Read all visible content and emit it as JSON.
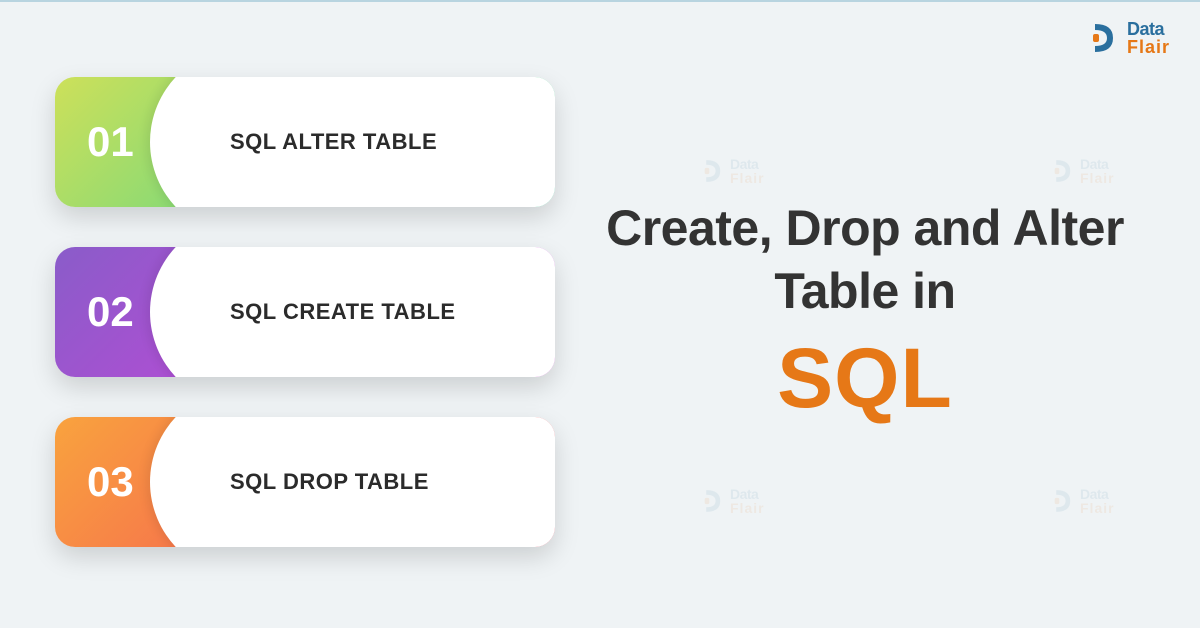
{
  "logo": {
    "top": "Data",
    "bottom": "Flair"
  },
  "cards": [
    {
      "num": "01",
      "label": "SQL ALTER TABLE"
    },
    {
      "num": "02",
      "label": "SQL CREATE TABLE"
    },
    {
      "num": "03",
      "label": "SQL DROP TABLE"
    }
  ],
  "title": {
    "line": "Create, Drop and Alter Table in",
    "highlight": "SQL"
  }
}
